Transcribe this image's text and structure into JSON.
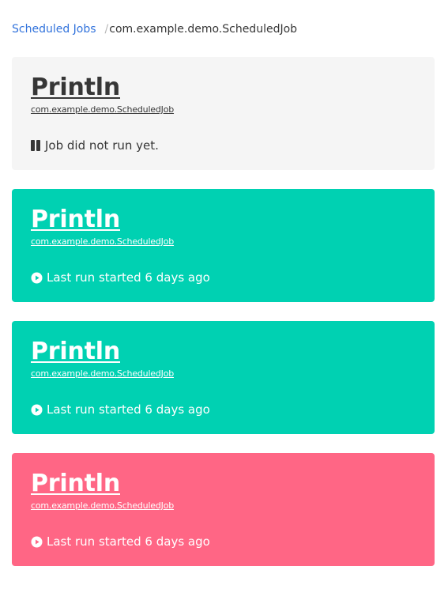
{
  "breadcrumb": {
    "parent_label": "Scheduled Jobs",
    "separator": "/",
    "current_label": "com.example.demo.ScheduledJob"
  },
  "jobs": [
    {
      "title": "Println",
      "class_name": "com.example.demo.ScheduledJob",
      "status": "Job did not run yet.",
      "state": "pending",
      "icon": "pause-icon",
      "background_color": "#f5f5f5"
    },
    {
      "title": "Println",
      "class_name": "com.example.demo.ScheduledJob",
      "status": "Last run started 6 days ago",
      "state": "success",
      "icon": "play-circle-icon",
      "background_color": "#00d1b2"
    },
    {
      "title": "Println",
      "class_name": "com.example.demo.ScheduledJob",
      "status": "Last run started 6 days ago",
      "state": "success",
      "icon": "play-circle-icon",
      "background_color": "#00d1b2"
    },
    {
      "title": "Println",
      "class_name": "com.example.demo.ScheduledJob",
      "status": "Last run started 6 days ago",
      "state": "failed",
      "icon": "play-circle-icon",
      "background_color": "#ff6685"
    }
  ],
  "colors": {
    "link": "#3273dc",
    "text": "#363636",
    "success": "#00d1b2",
    "danger": "#ff6685",
    "light": "#f5f5f5"
  }
}
